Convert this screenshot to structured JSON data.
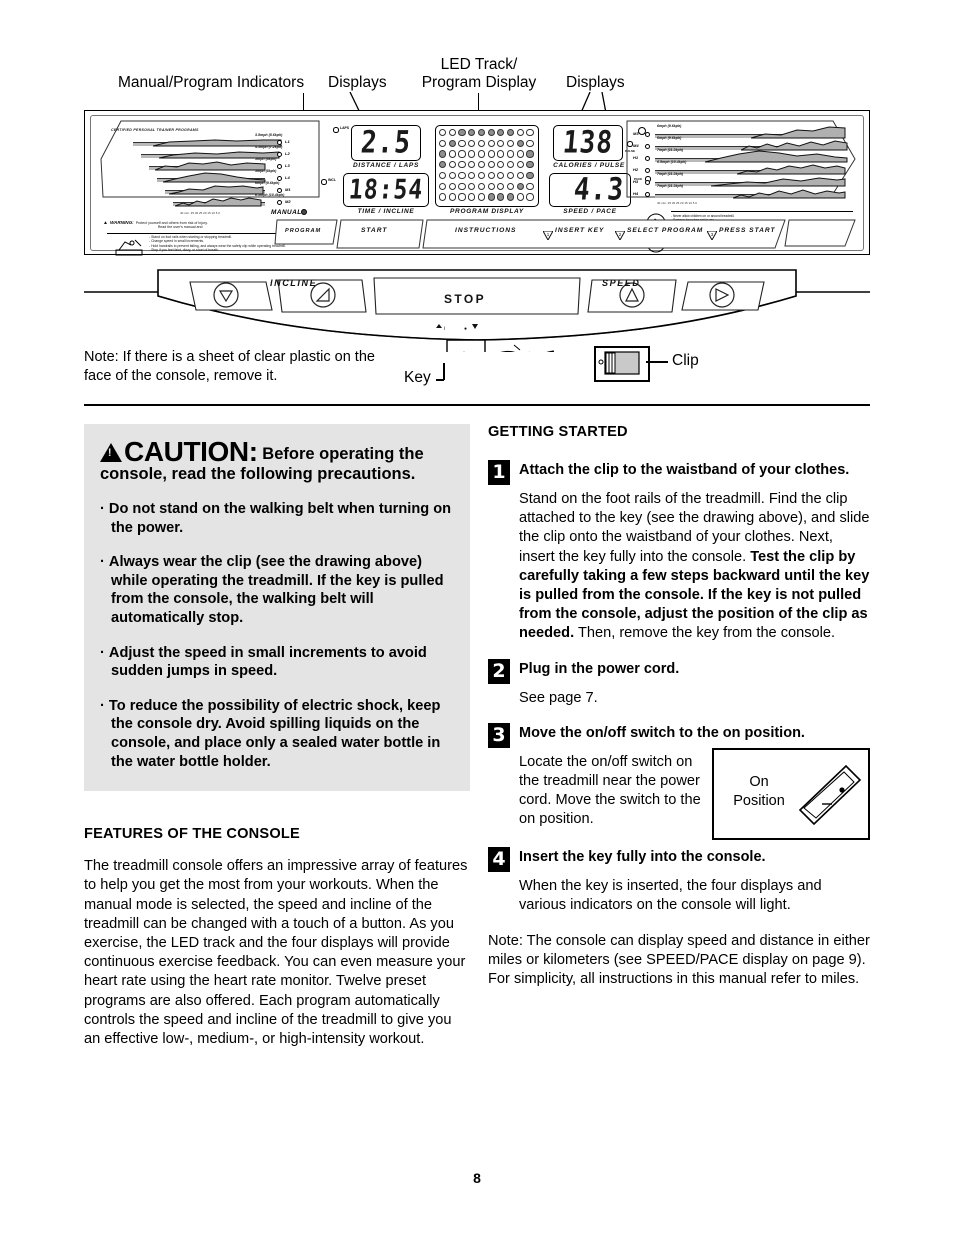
{
  "page": {
    "number": "8"
  },
  "callouts": {
    "manual_program_indicators": "Manual/Program Indicators",
    "displays_left": "Displays",
    "led_track": "LED Track/\nProgram Display",
    "led_track_l1": "LED Track/",
    "led_track_l2": "Program Display",
    "displays_right": "Displays"
  },
  "console": {
    "left_panel_title": "CERTIFIED PERSONAL TRAINER PROGRAMS",
    "manual_label": "MANUAL",
    "axis_left": "40 min.   35      30      25      20      15      10       5       0",
    "axis_right": "40 min.   35      30      25      20      15      10       5       0",
    "programs_left": [
      {
        "id": "L1",
        "spec": "3.5mph (5.6kph)"
      },
      {
        "id": "L2",
        "spec": "4.5mph (7.2kph)"
      },
      {
        "id": "L3",
        "spec": "5mph (8kph)"
      },
      {
        "id": "L4",
        "spec": "5mph (8kph)"
      },
      {
        "id": "M1",
        "spec": "6mph (9.6kph)"
      },
      {
        "id": "M2",
        "spec": "6.5mph (10.4kph)"
      }
    ],
    "programs_right": [
      {
        "id": "M3",
        "spec": "6mph (9.6kph)"
      },
      {
        "id": "M4",
        "spec": "6mph (9.6kph)"
      },
      {
        "id": "H1",
        "spec": "7mph (11.2kph)"
      },
      {
        "id": "H2",
        "spec": "6.5mph (10.4kph)"
      },
      {
        "id": "H3",
        "spec": "7mph (11.2kph)"
      },
      {
        "id": "H4",
        "spec": "7mph (11.2kph)"
      }
    ],
    "displays": [
      {
        "name": "distance",
        "value": "2.5",
        "caption": "DISTANCE / LAPS",
        "indicator": "LAPS"
      },
      {
        "name": "time",
        "value": "18:54",
        "caption": "TIME / INCLINE",
        "indicator": "INCL"
      },
      {
        "name": "calories",
        "value": "138",
        "caption": "CALORIES / PULSE",
        "indicator": "PULSE"
      },
      {
        "name": "speed",
        "value": "4.3",
        "caption": "SPEED / PACE",
        "indicator": "PACE"
      }
    ],
    "matrix_caption": "PROGRAM DISPLAY",
    "buttons": [
      {
        "label": "PROGRAM"
      },
      {
        "label": "START"
      },
      {
        "label": "INSTRUCTIONS"
      },
      {
        "label": "INSERT KEY",
        "step": "1"
      },
      {
        "label": "SELECT PROGRAM",
        "step": "2"
      },
      {
        "label": "PRESS START",
        "step": "3"
      }
    ],
    "warning_left": {
      "title": "WARNING:",
      "lead": "Protect yourself and others from risk of injury.",
      "lead2": "Read the user's manual and",
      "bullets": [
        "Stand on foot rails when starting or stopping treadmill.",
        "Change speed in small increments.",
        "Hold handrails to prevent falling, and always wear the safety clip while operating treadmill.",
        "Stop if you feel faint, dizzy, or short of breath."
      ]
    },
    "warning_right": {
      "bullets_top": [
        "Never allow children on or around treadmill.",
        "Remove key when not in use."
      ],
      "bullets_bottom": [
        "Keep clothing, fingers, and hair away from moving belt.",
        "Never try to adjust or fix the belt while it is moving.",
        "Always wear athletic shoes while operating treadmill."
      ]
    },
    "rail_buttons": {
      "incline": "INCLINE",
      "stop": "STOP",
      "speed": "SPEED"
    }
  },
  "diagram_labels": {
    "key": "Key",
    "clip": "Clip"
  },
  "note_left": "Note: If there is a sheet of clear plastic on the face of the console, remove it.",
  "caution": {
    "word": "CAUTION",
    "colon": ":",
    "lead": "Before operating the",
    "lead2": "console, read the following precautions.",
    "items": [
      "Do not stand on the walking belt when turning on the power.",
      "Always wear the clip (see the drawing above) while operating the treadmill. If the key is pulled from the console, the walking belt will automatically stop.",
      "Adjust the speed in small increments to avoid sudden jumps in speed.",
      "To reduce the possibility of electric shock, keep the console dry. Avoid spilling liquids on the console, and place only a sealed water bottle in the water bottle holder."
    ]
  },
  "features": {
    "heading": "FEATURES OF THE CONSOLE",
    "paragraph": "The treadmill console offers an impressive array of features to help you get the most from your workouts. When the manual mode is selected, the speed and incline of the treadmill can be changed with a touch of a button. As you exercise, the LED track and the four displays will provide continuous exercise feedback. You can even measure your heart rate using the heart rate monitor. Twelve preset programs are also offered. Each program automatically controls the speed and incline of the treadmill to give you an effective low-, medium-, or high-intensity workout."
  },
  "getting_started": {
    "heading": "GETTING STARTED",
    "steps": [
      {
        "num": "1",
        "title": "Attach the clip to the waistband of your clothes.",
        "body_a": "Stand on the foot rails of the treadmill. Find the clip attached to the key (see the drawing above), and slide the clip onto the waistband of your clothes. Next, insert the key fully into the console. ",
        "body_b": "Test the clip by carefully taking a few steps backward until the key is pulled from the console. If the key is not pulled from the console, adjust the position of the clip as needed.",
        "body_c": " Then, remove the key from the console."
      },
      {
        "num": "2",
        "title": "Plug in the power cord.",
        "body_a": "See page 7."
      },
      {
        "num": "3",
        "title": "Move the on/off switch to the on position.",
        "body_a": "Locate the on/off switch on the treadmill near the power cord. Move the switch to the on position.",
        "figure_label_1": "On",
        "figure_label_2": "Position"
      },
      {
        "num": "4",
        "title": "Insert the key fully into the console.",
        "body_a": "When the key is inserted, the four displays and various indicators on the console will light."
      }
    ],
    "note": "Note: The console can display speed and distance in either miles or kilometers (see SPEED/PACE display on page 9). For simplicity, all instructions in this manual refer to miles."
  }
}
